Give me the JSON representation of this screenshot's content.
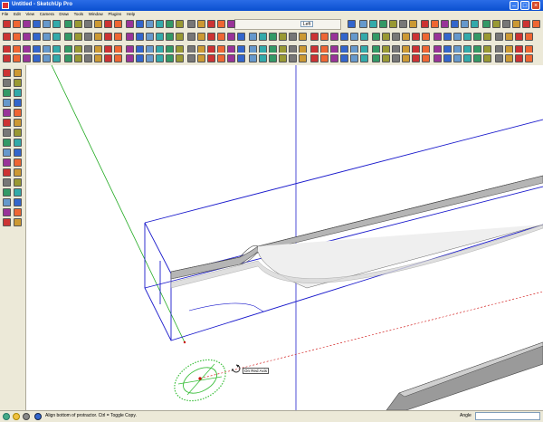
{
  "window": {
    "title": "Untitled - SketchUp Pro"
  },
  "menu": [
    "File",
    "Edit",
    "View",
    "Camera",
    "Draw",
    "Tools",
    "Window",
    "Plugins",
    "Help"
  ],
  "toolbar": {
    "scene_label": "Left"
  },
  "viewport": {
    "tooltip": "On Red Axis"
  },
  "status": {
    "hint": "Align bottom of protractor.  Ctrl = Toggle Copy.",
    "measure_label": "Angle",
    "measure_value": ""
  },
  "colors": {
    "red_axis": "#cc0000",
    "green_axis": "#22aa22",
    "blue_axis": "#2222cc",
    "selection": "#1a1acc",
    "protractor": "#3bbf3b"
  },
  "icons": {
    "sidebar": [
      "select-icon",
      "eraser-icon",
      "paint-icon",
      "line-icon",
      "rectangle-icon",
      "circle-icon",
      "polygon-icon",
      "arc-icon",
      "freehand-icon",
      "pushpull-icon",
      "move-icon",
      "rotate-icon",
      "followme-icon",
      "scale-icon",
      "offset-icon",
      "tape-icon",
      "protractor-icon",
      "axes-icon",
      "dimension-icon",
      "text-icon",
      "orbit-icon",
      "pan-icon",
      "zoom-icon",
      "zoom-window-icon",
      "zoom-extents-icon",
      "previous-icon",
      "walk-icon",
      "lookaround-icon",
      "position-camera-icon",
      "section-icon",
      "component-icon",
      "layers-icon"
    ]
  }
}
